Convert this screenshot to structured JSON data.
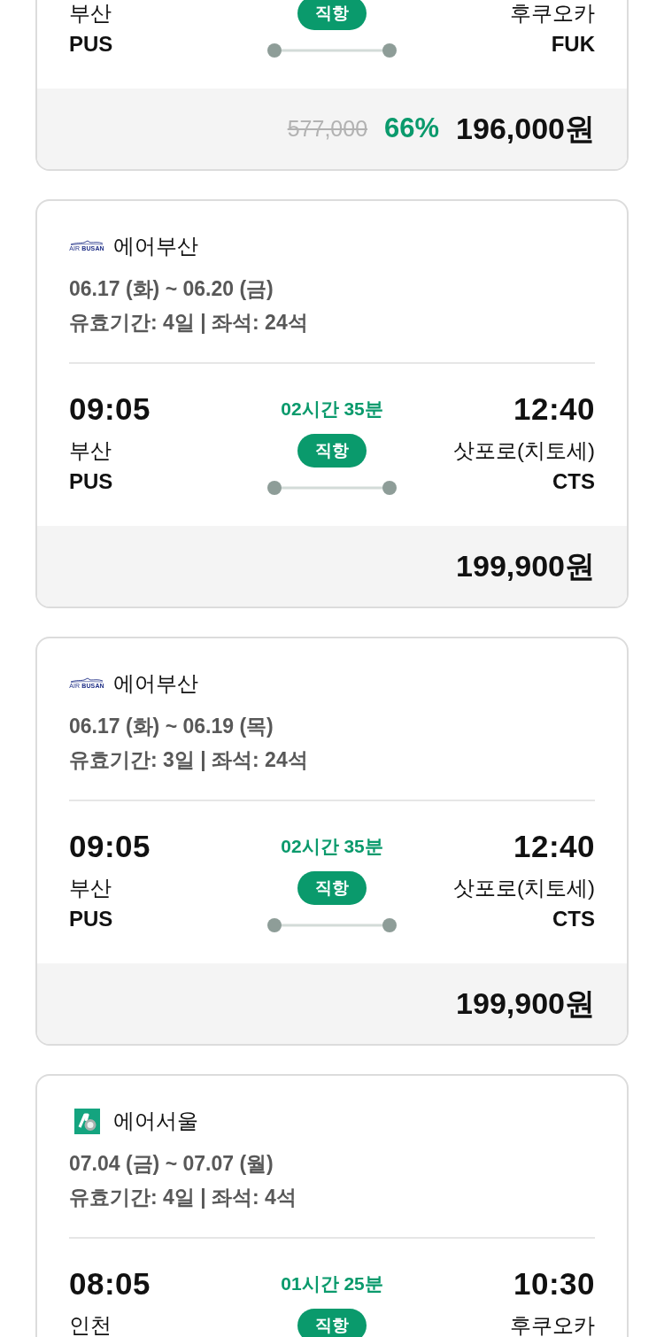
{
  "cards": [
    {
      "route": {
        "departure": {
          "city": "부산",
          "code": "PUS"
        },
        "stops": "직항",
        "arrival": {
          "city": "후쿠오카",
          "code": "FUK"
        }
      },
      "price": {
        "original": "577,000",
        "discount": "66%",
        "final": "196,000원"
      }
    },
    {
      "airline": {
        "logo": {
          "kind": "wordmark",
          "text": "AIR **BUSAN**"
        },
        "name": "에어부산"
      },
      "dates": "06.17 (화) ~ 06.20 (금)",
      "validity": "유효기간: 4일 | 좌석: 24석",
      "route": {
        "departure": {
          "time": "09:05",
          "city": "부산",
          "code": "PUS"
        },
        "duration": "02시간 35분",
        "stops": "직항",
        "arrival": {
          "time": "12:40",
          "city": "삿포로(치토세)",
          "code": "CTS"
        }
      },
      "price": {
        "final": "199,900원"
      }
    },
    {
      "airline": {
        "logo": {
          "kind": "wordmark",
          "text": "AIR **BUSAN**"
        },
        "name": "에어부산"
      },
      "dates": "06.17 (화) ~ 06.19 (목)",
      "validity": "유효기간: 3일 | 좌석: 24석",
      "route": {
        "departure": {
          "time": "09:05",
          "city": "부산",
          "code": "PUS"
        },
        "duration": "02시간 35분",
        "stops": "직항",
        "arrival": {
          "time": "12:40",
          "city": "삿포로(치토세)",
          "code": "CTS"
        }
      },
      "price": {
        "final": "199,900원"
      }
    },
    {
      "airline": {
        "logo": {
          "kind": "tile"
        },
        "name": "에어서울"
      },
      "dates": "07.04 (금) ~ 07.07 (월)",
      "validity": "유효기간: 4일 | 좌석: 4석",
      "route": {
        "departure": {
          "time": "08:05",
          "city": "인천"
        },
        "duration": "01시간 25분",
        "stops": "직항",
        "arrival": {
          "time": "10:30",
          "city": "후쿠오카"
        }
      }
    }
  ]
}
